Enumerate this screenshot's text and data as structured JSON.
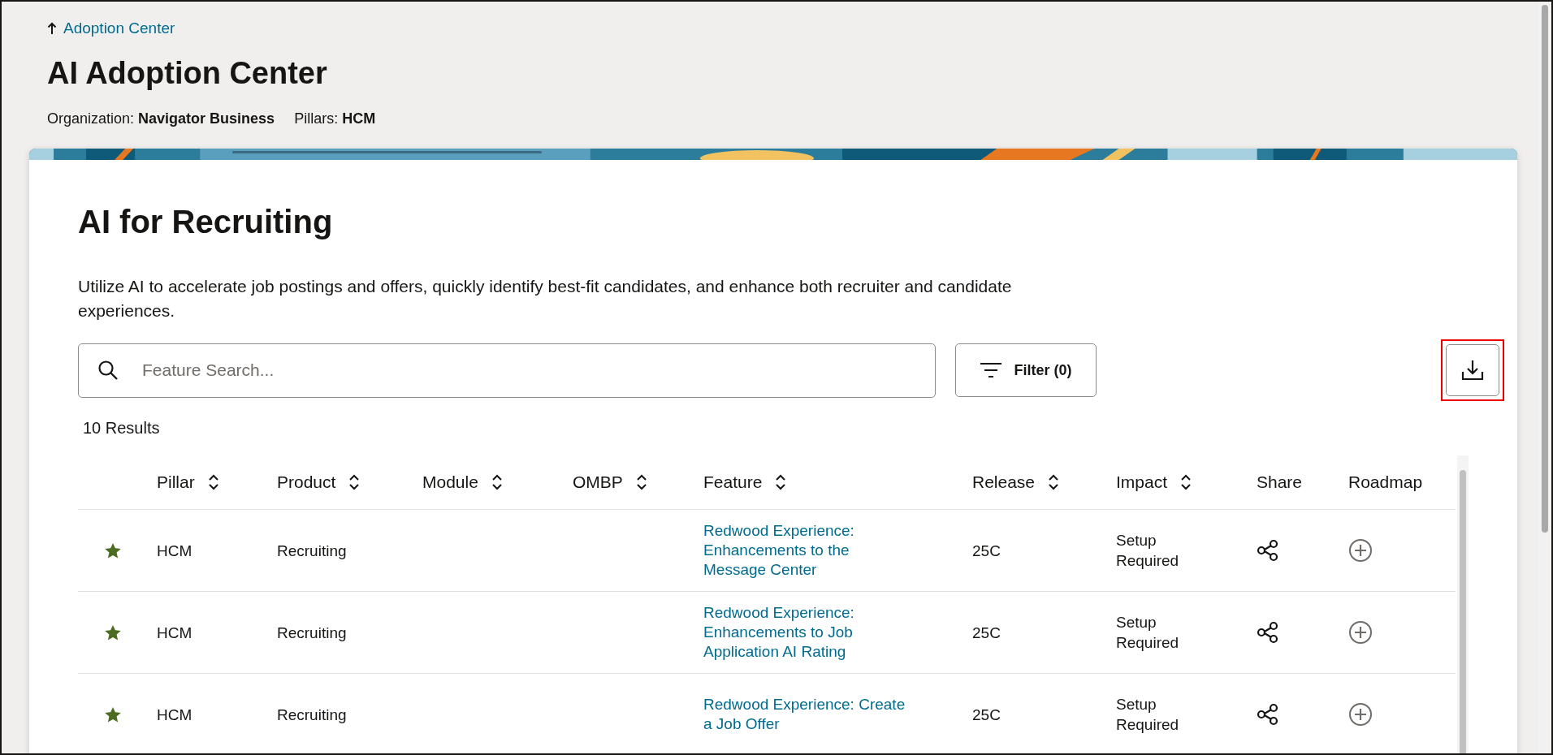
{
  "breadcrumb": {
    "label": "Adoption Center"
  },
  "page_title": "AI Adoption Center",
  "meta": [
    {
      "label": "Organization:",
      "value": "Navigator Business"
    },
    {
      "label": "Pillars:",
      "value": "HCM"
    }
  ],
  "section": {
    "title": "AI for Recruiting",
    "description": "Utilize AI to accelerate job postings and offers, quickly identify best-fit candidates, and enhance both recruiter and candidate experiences."
  },
  "search": {
    "placeholder": "Feature Search..."
  },
  "filter_button": {
    "label": "Filter (0)"
  },
  "download_button": {
    "highlighted": true
  },
  "results_count": "10 Results",
  "table": {
    "columns": [
      {
        "label": "Pillar",
        "sortable": true
      },
      {
        "label": "Product",
        "sortable": true
      },
      {
        "label": "Module",
        "sortable": true
      },
      {
        "label": "OMBP",
        "sortable": true
      },
      {
        "label": "Feature",
        "sortable": true
      },
      {
        "label": "Release",
        "sortable": true
      },
      {
        "label": "Impact",
        "sortable": true
      },
      {
        "label": "Share",
        "sortable": false
      },
      {
        "label": "Roadmap",
        "sortable": false
      }
    ],
    "rows": [
      {
        "starred": true,
        "pillar": "HCM",
        "product": "Recruiting",
        "feature": "Redwood Experience: Enhancements to the Message Center",
        "release": "25C",
        "impact": "Setup Required"
      },
      {
        "starred": true,
        "pillar": "HCM",
        "product": "Recruiting",
        "feature": "Redwood Experience: Enhancements to Job Application AI Rating",
        "release": "25C",
        "impact": "Setup Required"
      },
      {
        "starred": true,
        "pillar": "HCM",
        "product": "Recruiting",
        "feature": "Redwood Experience: Create a Job Offer",
        "release": "25C",
        "impact": "Setup Required"
      }
    ]
  }
}
